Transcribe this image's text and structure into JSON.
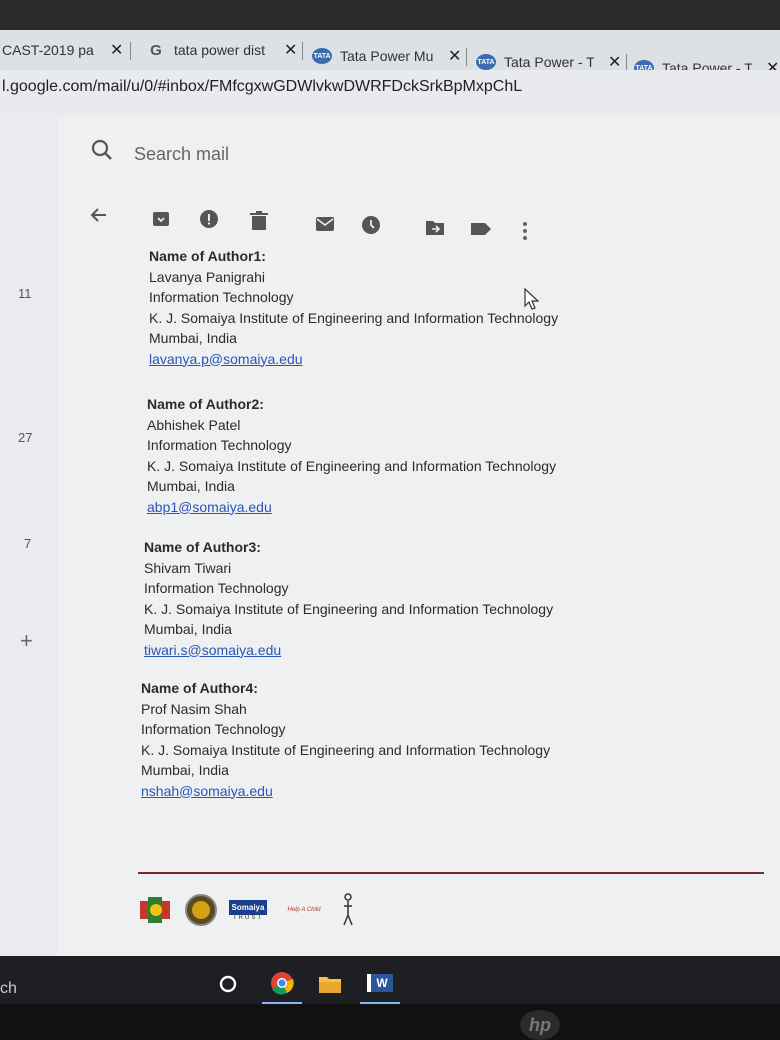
{
  "tabs": [
    {
      "title": "CAST-2019 pa",
      "close": "✕"
    },
    {
      "title": "tata power dist",
      "close": "✕",
      "icon": "G"
    },
    {
      "title": "Tata Power Mu",
      "close": "✕",
      "icon": "TATA"
    },
    {
      "title": "Tata Power - Th",
      "close": "✕",
      "icon": "TATA"
    },
    {
      "title": "Tata Power - Th",
      "close": "✕",
      "icon": "TATA"
    }
  ],
  "address": {
    "url": "l.google.com/mail/u/0/#inbox/FMfcgxwGDWlvkwDWRFDckSrkBpMxpChL"
  },
  "search": {
    "placeholder": "Search mail"
  },
  "rail": {
    "counts": [
      "11",
      "27",
      "7"
    ],
    "add": "+"
  },
  "authors": [
    {
      "label": "Name of Author1:",
      "name": "Lavanya Panigrahi",
      "dept": "Information Technology",
      "institute": "K. J. Somaiya Institute of Engineering and Information Technology",
      "city": "Mumbai, India",
      "email": "lavanya.p@somaiya.edu"
    },
    {
      "label": "Name of Author2:",
      "name": "Abhishek Patel",
      "dept": "Information Technology",
      "institute": "K. J. Somaiya Institute of Engineering and Information Technology",
      "city": "Mumbai, India",
      "email": "abp1@somaiya.edu"
    },
    {
      "label": "Name of Author3:",
      "name": "Shivam Tiwari",
      "dept": "Information Technology",
      "institute": "K. J. Somaiya Institute of Engineering and Information Technology",
      "city": "Mumbai, India",
      "email": "tiwari.s@somaiya.edu"
    },
    {
      "label": "Name of Author4:",
      "name": "Prof Nasim Shah",
      "dept": "Information Technology",
      "institute": "K. J. Somaiya Institute of Engineering and Information Technology",
      "city": "Mumbai, India",
      "email": "nshah@somaiya.edu"
    }
  ],
  "footer_logos": {
    "trust": "Somaiya",
    "trust_sub": "TRUST",
    "help": "Help A Child"
  },
  "taskbar": {
    "left_text": "ch",
    "word_label": "W"
  },
  "device": {
    "brand": "hp"
  },
  "colors": {
    "link": "#2a55b8",
    "divider": "#7a2a2a",
    "taskbar": "#1d1f22"
  }
}
